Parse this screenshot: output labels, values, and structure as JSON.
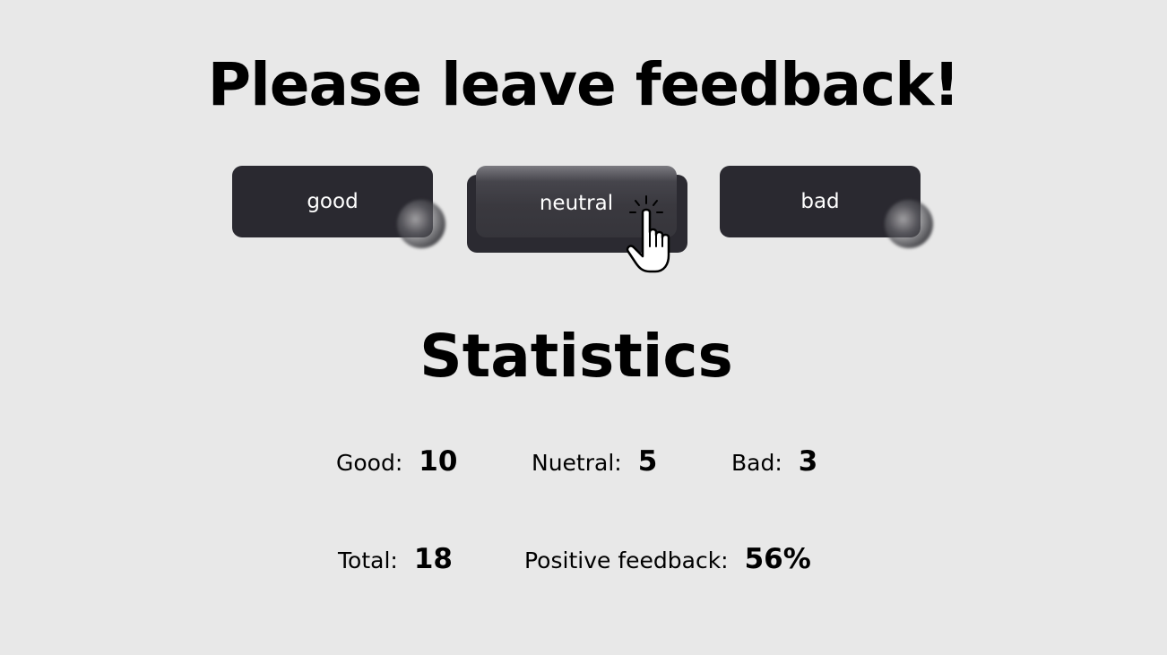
{
  "page": {
    "title": "Please leave feedback!"
  },
  "buttons": {
    "good": "good",
    "neutral": "neutral",
    "bad": "bad"
  },
  "statistics": {
    "title": "Statistics",
    "good_label": "Good:",
    "good_value": "10",
    "neutral_label": "Nuetral:",
    "neutral_value": "5",
    "bad_label": "Bad:",
    "bad_value": "3",
    "total_label": "Total:",
    "total_value": "18",
    "positive_label": "Positive feedback:",
    "positive_value": "56%"
  },
  "colors": {
    "background": "#e8e8e8",
    "button": "#2a2930",
    "button_text": "#ffffff",
    "text": "#000000"
  },
  "icons": {
    "cursor": "hand-pointer-click-icon"
  }
}
